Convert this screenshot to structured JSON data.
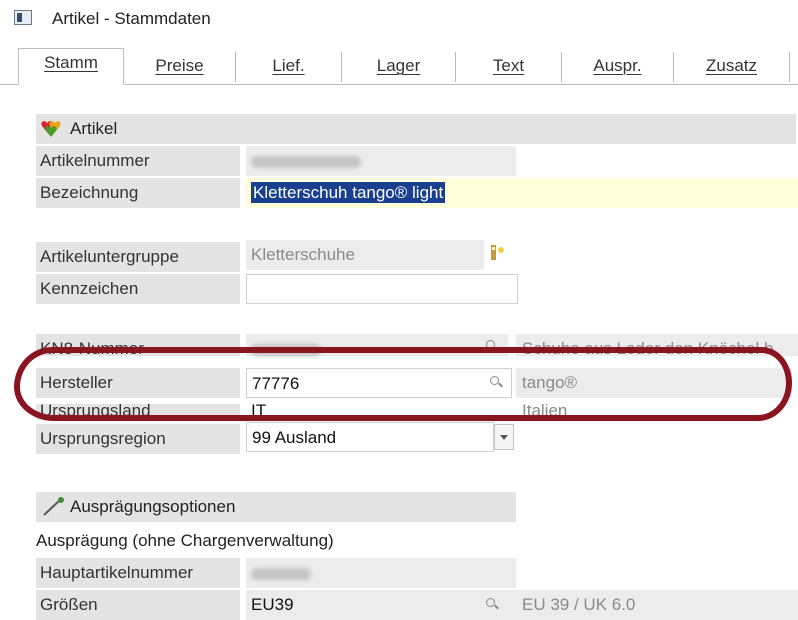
{
  "window": {
    "title": "Artikel - Stammdaten",
    "icon": "window-icon"
  },
  "tabs": [
    {
      "label": "Stamm",
      "active": true
    },
    {
      "label": "Preise"
    },
    {
      "label": "Lief."
    },
    {
      "label": "Lager"
    },
    {
      "label": "Text"
    },
    {
      "label": "Auspr."
    },
    {
      "label": "Zusatz"
    }
  ],
  "section_artikel": {
    "title": "Artikel",
    "icon": "hearts-icon"
  },
  "fields": {
    "artikelnummer": {
      "label": "Artikelnummer",
      "value": ""
    },
    "bezeichnung": {
      "label": "Bezeichnung",
      "value": "Kletterschuh  tango® light"
    },
    "artikeluntergruppe": {
      "label": "Artikeluntergruppe",
      "value": "Kletterschuhe"
    },
    "kennzeichen": {
      "label": "Kennzeichen",
      "value": ""
    },
    "kn8": {
      "label": "KN8-Nummer",
      "value": "",
      "description": "Schuhe aus Leder den Knöchel b"
    },
    "hersteller": {
      "label": "Hersteller",
      "value": "77776",
      "description": "tango®"
    },
    "ursprungsland": {
      "label": "Ursprungsland",
      "value": "IT",
      "description": "Italien"
    },
    "ursprungsregion": {
      "label": "Ursprungsregion",
      "value": "99 Ausland"
    }
  },
  "section_auspraegung": {
    "title": "Ausprägungsoptionen",
    "icon": "wand-icon"
  },
  "auspraegung_line": "Ausprägung (ohne Chargenverwaltung)",
  "fields2": {
    "hauptartikelnummer": {
      "label": "Hauptartikelnummer",
      "value": ""
    },
    "groessen": {
      "label": "Größen",
      "value": "EU39",
      "description": "EU 39  /  UK 6.0"
    }
  },
  "colors": {
    "highlight": "#8a1420",
    "selection": "#1a3f8f",
    "label_bg": "#e4e4e4"
  }
}
